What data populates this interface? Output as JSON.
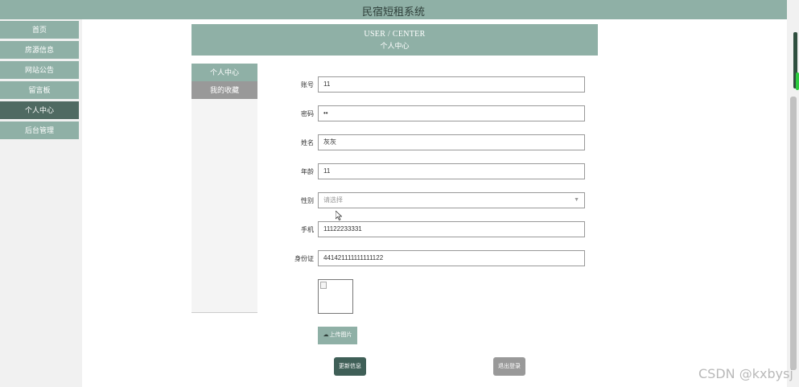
{
  "app": {
    "title": "民宿短租系统"
  },
  "nav": {
    "items": [
      {
        "label": "首页",
        "active": false
      },
      {
        "label": "房源信息",
        "active": false
      },
      {
        "label": "网站公告",
        "active": false
      },
      {
        "label": "留言板",
        "active": false
      },
      {
        "label": "个人中心",
        "active": true
      },
      {
        "label": "后台管理",
        "active": false
      }
    ]
  },
  "header": {
    "en": "USER / CENTER",
    "zh": "个人中心"
  },
  "side_tabs": [
    {
      "label": "个人中心",
      "active": true
    },
    {
      "label": "我的收藏",
      "active": false
    }
  ],
  "form": {
    "fields": [
      {
        "label": "账号",
        "value": "11"
      },
      {
        "label": "密码",
        "value": "••"
      },
      {
        "label": "姓名",
        "value": "灰灰"
      },
      {
        "label": "年龄",
        "value": "11"
      },
      {
        "label": "性别",
        "value": "请选择",
        "type": "select"
      },
      {
        "label": "手机",
        "value": "11122233331"
      },
      {
        "label": "身份证",
        "value": "441421111111111122"
      }
    ],
    "upload_label": "上传图片",
    "upload_icon": "cloud-upload-icon"
  },
  "actions": {
    "update": "更新信息",
    "logout": "退出登录"
  },
  "watermark": "CSDN @kxbysj",
  "colors": {
    "accent": "#8fb0a6",
    "active_nav": "#4f6a62",
    "update_btn": "#3f5f57",
    "grey_btn": "#999999"
  }
}
